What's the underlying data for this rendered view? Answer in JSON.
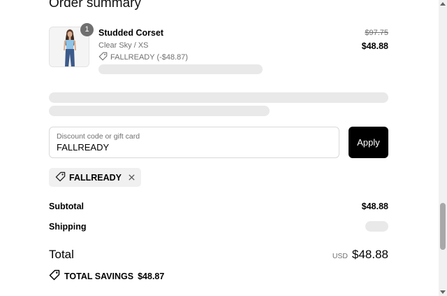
{
  "heading": "Order summary",
  "product": {
    "name": "Studded Corset",
    "variant": "Clear Sky / XS",
    "discount_label": "FALLREADY (-$48.87)",
    "quantity": "1",
    "original_price": "$97.75",
    "price": "$48.88"
  },
  "discount": {
    "placeholder": "Discount code or gift card",
    "value": "FALLREADY",
    "apply_label": "Apply",
    "applied_code": "FALLREADY"
  },
  "totals": {
    "subtotal_label": "Subtotal",
    "subtotal_value": "$48.88",
    "shipping_label": "Shipping",
    "total_label": "Total",
    "currency": "USD",
    "total_value": "$48.88",
    "savings_label": "TOTAL SAVINGS",
    "savings_value": "$48.87"
  },
  "icons": {
    "tag": "tag-icon",
    "remove": "close-icon"
  },
  "colors": {
    "button_bg": "#000000",
    "skeleton": "#e9e9e9",
    "badge": "#6f6f6f"
  }
}
